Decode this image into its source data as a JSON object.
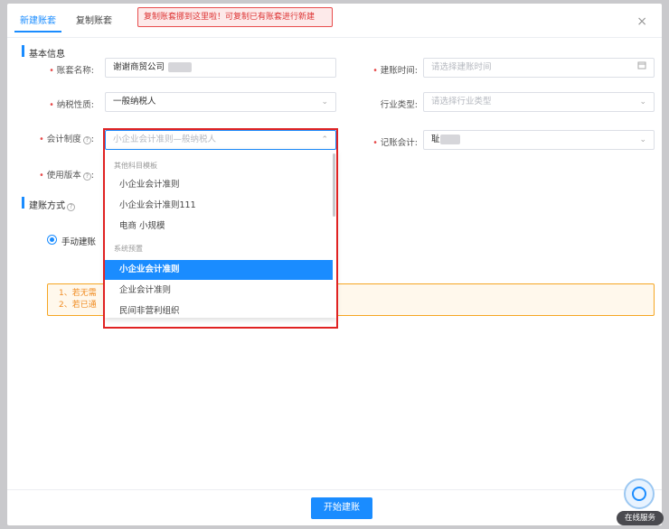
{
  "tabs": [
    {
      "label": "新建账套",
      "active": true
    },
    {
      "label": "复制账套",
      "active": false
    }
  ],
  "annotation_tip": "复制账套挪到这里啦！可复制已有账套进行新建",
  "close_symbol": "×",
  "section_basic": "基本信息",
  "fields": {
    "account_name": {
      "label": "账套名称:",
      "value": "谢谢商贸公司"
    },
    "create_time": {
      "label": "建账时间:",
      "placeholder": "请选择建账时间",
      "icon": "calendar-icon"
    },
    "tax_type": {
      "label": "纳税性质:",
      "value": "一般纳税人"
    },
    "industry": {
      "label": "行业类型:",
      "placeholder": "请选择行业类型"
    },
    "accounting_system": {
      "label": "会计制度",
      "value": "小企业会计准则—般纳税人"
    },
    "accountant": {
      "label": "记账会计:",
      "value": "耻"
    },
    "version": {
      "label": "使用版本"
    }
  },
  "dropdown": {
    "group1": "其他科目模板",
    "group1_items": [
      "小企业会计准则",
      "小企业会计准则111",
      "电商 小规模"
    ],
    "group2": "系统预置",
    "group2_items": [
      "小企业会计准则",
      "企业会计准则",
      "民间非营利组织"
    ],
    "selected": "小企业会计准则"
  },
  "section_method": "建账方式",
  "method_option": "手动建账",
  "notice_lines": [
    "1、若无需",
    "2、若已通"
  ],
  "start_button": "开始建账",
  "service_label": "在线服务",
  "colors": {
    "accent": "#1a8cff",
    "warning": "#f5a623",
    "annotation_red": "#e02222"
  }
}
